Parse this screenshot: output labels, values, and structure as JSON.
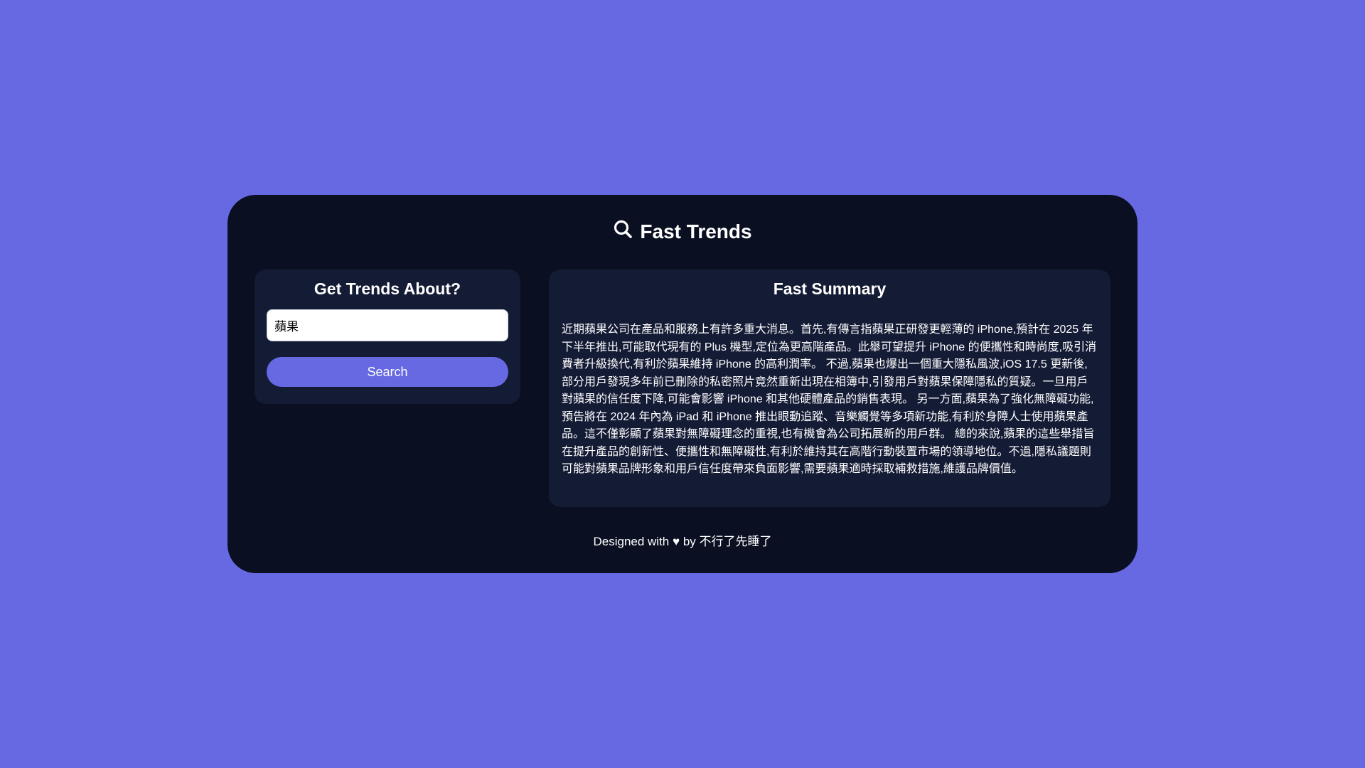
{
  "header": {
    "title": "Fast Trends",
    "icon": "search-icon"
  },
  "search_panel": {
    "heading": "Get Trends About?",
    "input_value": "蘋果",
    "button_label": "Search"
  },
  "summary_panel": {
    "heading": "Fast Summary",
    "text": "近期蘋果公司在產品和服務上有許多重大消息。首先,有傳言指蘋果正研發更輕薄的 iPhone,預計在 2025 年下半年推出,可能取代現有的 Plus 機型,定位為更高階產品。此舉可望提升 iPhone 的便攜性和時尚度,吸引消費者升級換代,有利於蘋果維持 iPhone 的高利潤率。 不過,蘋果也爆出一個重大隱私風波,iOS 17.5 更新後,部分用戶發現多年前已刪除的私密照片竟然重新出現在相簿中,引發用戶對蘋果保障隱私的質疑。一旦用戶對蘋果的信任度下降,可能會影響 iPhone 和其他硬體產品的銷售表現。 另一方面,蘋果為了強化無障礙功能,預告將在 2024 年內為 iPad 和 iPhone 推出眼動追蹤、音樂觸覺等多項新功能,有利於身障人士使用蘋果產品。這不僅彰顯了蘋果對無障礙理念的重視,也有機會為公司拓展新的用戶群。 總的來說,蘋果的這些舉措旨在提升產品的創新性、便攜性和無障礙性,有利於維持其在高階行動裝置市場的領導地位。不過,隱私議題則可能對蘋果品牌形象和用戶信任度帶來負面影響,需要蘋果適時採取補救措施,維護品牌價值。"
  },
  "footer": {
    "prefix": "Designed with",
    "icon": "heart-icon",
    "suffix": "by 不行了先睡了"
  },
  "colors": {
    "background": "#6769e3",
    "card": "#0a0f22",
    "panel": "#141b35",
    "accent": "#6769e3"
  }
}
